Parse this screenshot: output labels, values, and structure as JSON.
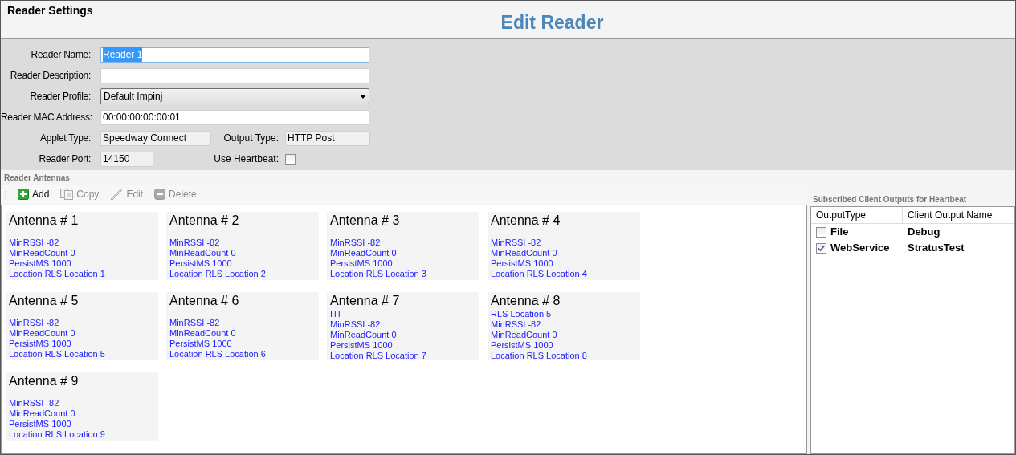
{
  "window": {
    "title": "Reader Settings"
  },
  "heading": "Edit Reader",
  "form": {
    "name": {
      "label": "Reader Name:",
      "value": "Reader 1",
      "text_selected": true
    },
    "description": {
      "label": "Reader Description:"
    },
    "profile": {
      "label": "Reader Profile:",
      "value": "Default Impinj"
    },
    "mac": {
      "label": "Reader MAC Address:",
      "value": "00:00:00:00:00:01"
    },
    "applet_type": {
      "label": "Applet Type:",
      "value": "Speedway Connect"
    },
    "output_type": {
      "label": "Output Type:",
      "value": "HTTP Post"
    },
    "port": {
      "label": "Reader Port:",
      "value": "14150"
    },
    "heartbeat": {
      "label": "Use Heartbeat:",
      "checked": false
    }
  },
  "antennas_section": {
    "title": "Reader Antennas",
    "toolbar": [
      {
        "kind": "add",
        "label": "Add",
        "disabled": false
      },
      {
        "kind": "copy",
        "label": "Copy",
        "disabled": true
      },
      {
        "kind": "edit",
        "label": "Edit",
        "disabled": true
      },
      {
        "kind": "delete",
        "label": "Delete",
        "disabled": true
      }
    ],
    "antennas": [
      {
        "title": "Antenna # 1",
        "lines": [
          "MinRSSI -82",
          "MinReadCount 0",
          "PersistMS 1000",
          "Location RLS Location 1"
        ]
      },
      {
        "title": "Antenna # 2",
        "lines": [
          "MinRSSI -82",
          "MinReadCount 0",
          "PersistMS 1000",
          "Location RLS Location 2"
        ]
      },
      {
        "title": "Antenna # 3",
        "lines": [
          "MinRSSI -82",
          "MinReadCount 0",
          "PersistMS 1000",
          "Location RLS Location 3"
        ]
      },
      {
        "title": "Antenna # 4",
        "lines": [
          "MinRSSI -82",
          "MinReadCount 0",
          "PersistMS 1000",
          "Location RLS Location 4"
        ]
      },
      {
        "title": "Antenna # 5",
        "lines": [
          "MinRSSI -82",
          "MinReadCount 0",
          "PersistMS 1000",
          "Location RLS Location 5"
        ]
      },
      {
        "title": "Antenna # 6",
        "lines": [
          "MinRSSI -82",
          "MinReadCount 0",
          "PersistMS 1000",
          "Location RLS Location 6"
        ]
      },
      {
        "title": "Antenna # 7",
        "lines": [
          "ITI",
          "MinRSSI -82",
          "MinReadCount 0",
          "PersistMS 1000",
          "Location RLS Location 7"
        ]
      },
      {
        "title": "Antenna # 8",
        "lines": [
          "RLS Location 5",
          "MinRSSI -82",
          "MinReadCount 0",
          "PersistMS 1000",
          "Location RLS Location 8"
        ]
      },
      {
        "title": "Antenna # 9",
        "lines": [
          "MinRSSI -82",
          "MinReadCount 0",
          "PersistMS 1000",
          "Location RLS Location 9"
        ]
      }
    ]
  },
  "heartbeat_outputs": {
    "title": "Subscribed Client Outputs for Heartbeat",
    "columns": [
      "OutputType",
      "Client Output Name"
    ],
    "rows": [
      {
        "type": "File",
        "name": "Debug",
        "checked": false
      },
      {
        "type": "WebService",
        "name": "StratusTest",
        "checked": true
      }
    ]
  }
}
